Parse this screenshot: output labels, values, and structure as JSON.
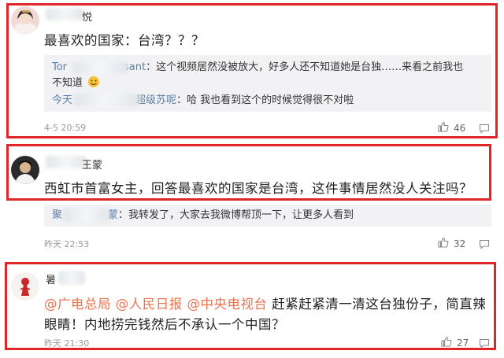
{
  "comments": [
    {
      "username_visible": "悦",
      "text": "最喜欢的国家：台湾？？？",
      "replies": [
        {
          "user_prefix": "Tor",
          "user_suffix": "sant",
          "text": "：这个视频居然没被放大，好多人还不知道她是台独……来看之前我也",
          "text2": "不知道"
        },
        {
          "user_prefix": "今天",
          "user_suffix": "超级苏呢",
          "text": "：哈 我也看到这个的时候觉得很不对啦"
        }
      ],
      "time": "4-5 20:59",
      "likes": "46"
    },
    {
      "username_visible": "王蒙",
      "text": "西虹市首富女主，回答最喜欢的国家是台湾，这件事情居然没人关注吗？",
      "replies": [
        {
          "user_prefix": "聚",
          "user_suffix": "蒙",
          "text": "：我转发了，大家去我微博帮顶一下，让更多人看到"
        }
      ],
      "time": "昨天 22:53",
      "likes": "32"
    },
    {
      "username_visible": "暑",
      "mentions": [
        "@广电总局",
        "@人民日报",
        "@中央电视台"
      ],
      "text": "赶紧赶紧清一清这台独份子，简直辣",
      "text2": "眼睛！内地捞完钱然后不承认一个中国？",
      "time": "昨天 21:30",
      "likes": "27"
    }
  ],
  "colors": {
    "frame": "#e0262a",
    "link": "#5d7fa6",
    "mention": "#eb7350",
    "reply_bg": "#f2f2f5"
  }
}
